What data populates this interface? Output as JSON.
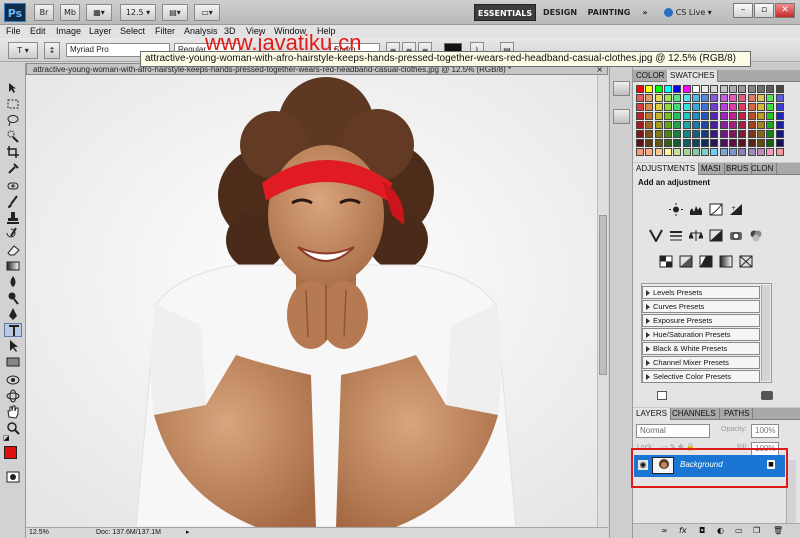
{
  "app": {
    "logo": "Ps",
    "zoom": "12.5"
  },
  "workspace": {
    "buttons": [
      "ESSENTIALS",
      "DESIGN",
      "PAINTING"
    ],
    "more": "»",
    "cs_live": "CS Live"
  },
  "menu": [
    "File",
    "Edit",
    "Image",
    "Layer",
    "Select",
    "Filter",
    "Analysis",
    "3D",
    "View",
    "Window",
    "Help"
  ],
  "options": {
    "font_family": "Myriad Pro",
    "font_style": "Regular",
    "antialias": "Sharp"
  },
  "watermark": "www.javatiku.cn",
  "tooltip": "attractive-young-woman-with-afro-hairstyle-keeps-hands-pressed-together-wears-red-headband-casual-clothes.jpg @ 12.5% (RGB/8)",
  "document": {
    "tab_title": "attractive-young-woman-with-afro-hairstyle-keeps-hands-pressed-together-wears-red-headband-casual-clothes.jpg @ 12.5% (RGB/8) *",
    "zoom": "12.5%",
    "doc_size": "Doc: 137.6M/137.1M"
  },
  "colors": {
    "foreground": "#e01010",
    "background": "#ffffff",
    "layer_selected": "#1a76d2"
  },
  "color_panel": {
    "tabs": [
      "COLOR",
      "SWATCHES"
    ]
  },
  "adjustments": {
    "tabs": [
      "ADJUSTMENTS",
      "MASI",
      "BRUS",
      "CLON"
    ],
    "heading": "Add an adjustment",
    "presets": [
      "Levels Presets",
      "Curves Presets",
      "Exposure Presets",
      "Hue/Saturation Presets",
      "Black & White Presets",
      "Channel Mixer Presets",
      "Selective Color Presets"
    ]
  },
  "layers": {
    "tabs": [
      "LAYERS",
      "CHANNELS",
      "PATHS"
    ],
    "blend_mode": "Normal",
    "opacity_label": "Opacity:",
    "opacity": "100%",
    "lock_label": "Lock:",
    "fill_label": "Fill:",
    "fill": "100%",
    "items": [
      {
        "name": "Background"
      }
    ]
  }
}
